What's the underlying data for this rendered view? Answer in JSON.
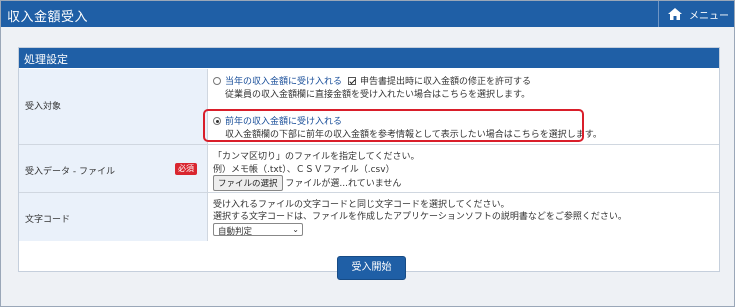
{
  "app": {
    "title": "収入金額受入",
    "menu_label": "メニュー"
  },
  "section": {
    "title": "処理設定"
  },
  "target_row": {
    "label": "受入対象",
    "option1": {
      "label": "当年の収入金額に受け入れる",
      "checkbox_label": "申告書提出時に収入金額の修正を許可する",
      "desc": "従業員の収入金額欄に直接金額を受け入れたい場合はこちらを選択します。",
      "checked": false
    },
    "option2": {
      "label": "前年の収入金額に受け入れる",
      "desc": "収入金額欄の下部に前年の収入金額を参考情報として表示したい場合はこちらを選択します。",
      "checked": true
    }
  },
  "file_row": {
    "label": "受入データ - ファイル",
    "required": "必須",
    "line1": "「カンマ区切り」のファイルを指定してください。",
    "line2": "例）メモ帳（.txt）、ＣＳＶファイル（.csv）",
    "button": "ファイルの選択",
    "status": "ファイルが選...れていません"
  },
  "charset_row": {
    "label": "文字コード",
    "line1": "受け入れるファイルの文字コードと同じ文字コードを選択してください。",
    "line2": "選択する文字コードは、ファイルを作成したアプリケーションソフトの説明書などをご参照ください。",
    "select_value": "自動判定"
  },
  "start_button": "受入開始",
  "colors": {
    "header": "#1f5fa6",
    "highlight": "#d91e2a",
    "badge": "#d9262f"
  }
}
